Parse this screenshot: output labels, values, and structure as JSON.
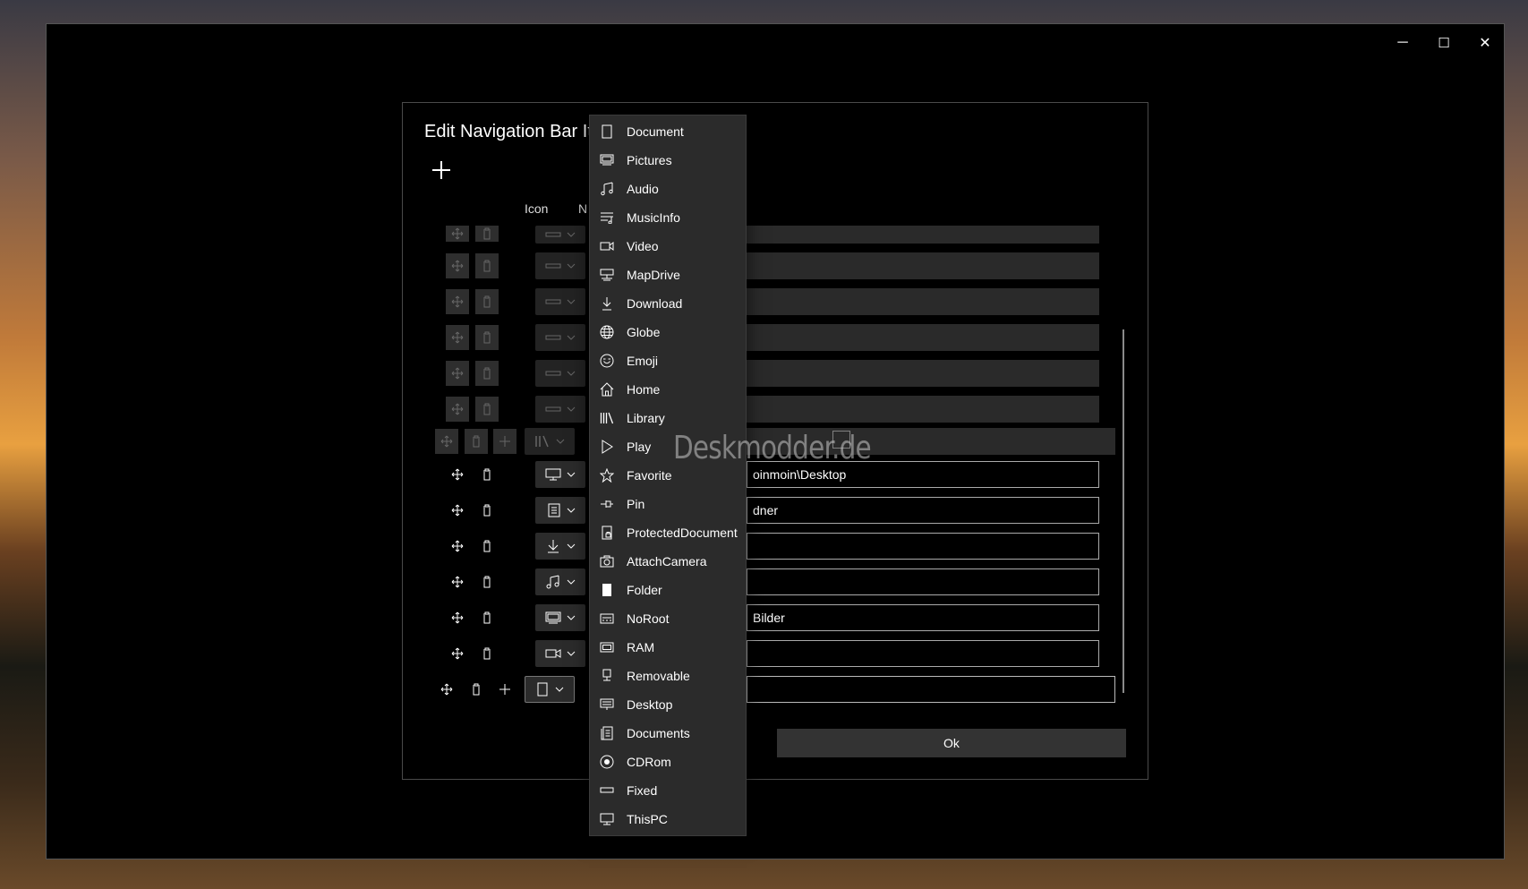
{
  "window": {
    "caption": {
      "minimize": "─",
      "maximize": "☐",
      "close": "✕"
    }
  },
  "dialog": {
    "title": "Edit Navigation Bar It",
    "columns": {
      "icon": "Icon",
      "name": "N"
    },
    "rows": [
      {
        "text": "oinmoin\\Desktop"
      },
      {
        "text": "dner"
      },
      {
        "text": ""
      },
      {
        "text": ""
      },
      {
        "text": "Bilder"
      },
      {
        "text": ""
      },
      {
        "text": ""
      }
    ],
    "ok_label": "Ok"
  },
  "menu": {
    "items": [
      {
        "label": "Document",
        "icon": "document-icon"
      },
      {
        "label": "Pictures",
        "icon": "pictures-icon"
      },
      {
        "label": "Audio",
        "icon": "audio-icon"
      },
      {
        "label": "MusicInfo",
        "icon": "musicinfo-icon"
      },
      {
        "label": "Video",
        "icon": "video-icon"
      },
      {
        "label": "MapDrive",
        "icon": "mapdrive-icon"
      },
      {
        "label": "Download",
        "icon": "download-icon"
      },
      {
        "label": "Globe",
        "icon": "globe-icon"
      },
      {
        "label": "Emoji",
        "icon": "emoji-icon"
      },
      {
        "label": "Home",
        "icon": "home-icon"
      },
      {
        "label": "Library",
        "icon": "library-icon"
      },
      {
        "label": "Play",
        "icon": "play-icon"
      },
      {
        "label": "Favorite",
        "icon": "favorite-icon"
      },
      {
        "label": "Pin",
        "icon": "pin-icon"
      },
      {
        "label": "ProtectedDocument",
        "icon": "protected-document-icon"
      },
      {
        "label": "AttachCamera",
        "icon": "attach-camera-icon"
      },
      {
        "label": "Folder",
        "icon": "folder-icon"
      },
      {
        "label": "NoRoot",
        "icon": "noroot-icon"
      },
      {
        "label": "RAM",
        "icon": "ram-icon"
      },
      {
        "label": "Removable",
        "icon": "removable-icon"
      },
      {
        "label": "Desktop",
        "icon": "desktop-icon"
      },
      {
        "label": "Documents",
        "icon": "documents-icon"
      },
      {
        "label": "CDRom",
        "icon": "cdrom-icon"
      },
      {
        "label": "Fixed",
        "icon": "fixed-icon"
      },
      {
        "label": "ThisPC",
        "icon": "thispc-icon"
      }
    ]
  },
  "watermark": "Deskmodder.de"
}
